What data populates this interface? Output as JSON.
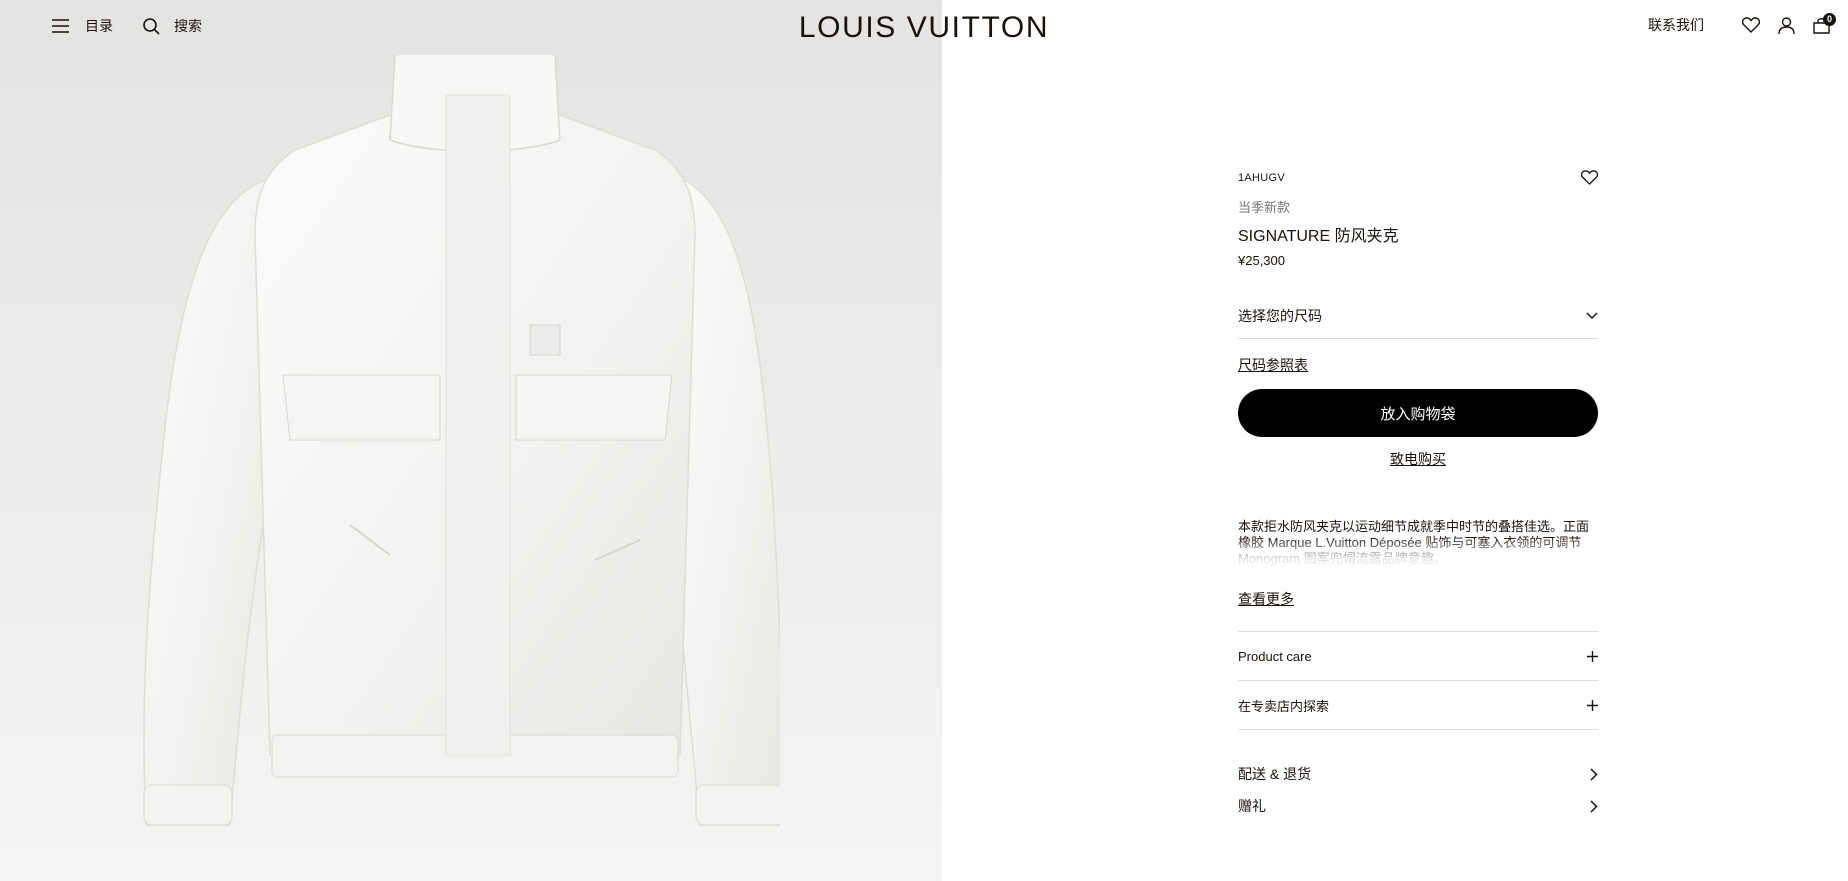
{
  "header": {
    "menu_label": "目录",
    "search_label": "搜索",
    "logo": "LOUIS VUITTON",
    "contact_label": "联系我们",
    "bag_count": "0"
  },
  "product": {
    "sku": "1AHUGV",
    "tag": "当季新款",
    "name": "SIGNATURE 防风夹克",
    "price": "¥25,300",
    "size_select": "选择您的尺码",
    "size_guide": "尺码参照表",
    "add_to_bag": "放入购物袋",
    "call_to_buy": "致电购买",
    "description": "本款拒水防风夹克以运动细节成就季中时节的叠搭佳选。正面橡胶 Marque L.Vuitton Déposée 贴饰与可塞入衣领的可调节 Monogram 图案兜帽流露品牌意趣。",
    "see_more": "查看更多"
  },
  "accordions": [
    {
      "label": "Product care",
      "icon": "plus-icon"
    },
    {
      "label": "在专卖店内探索",
      "icon": "plus-icon"
    }
  ],
  "links": [
    {
      "label": "配送 & 退货",
      "icon": "chevron-right-icon"
    },
    {
      "label": "赠礼",
      "icon": "chevron-right-icon"
    }
  ],
  "colors": {
    "text": "#19110b",
    "muted": "#767676",
    "divider": "#e1dfdd",
    "button": "#000000"
  }
}
